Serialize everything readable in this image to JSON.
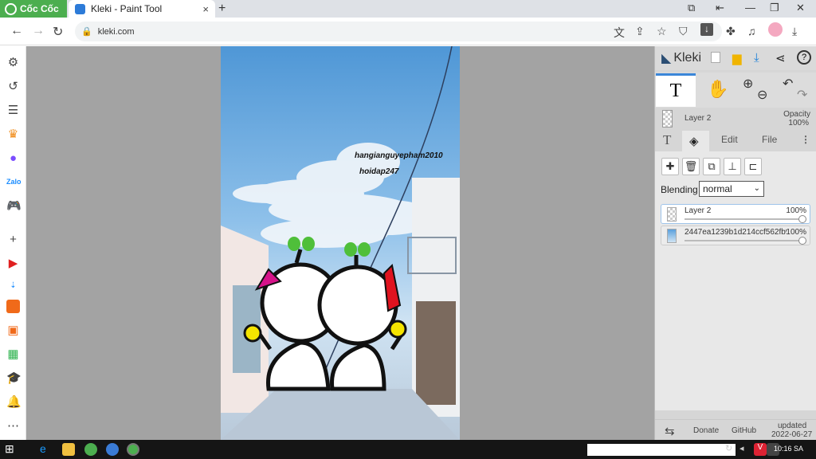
{
  "browser": {
    "brand": "Cốc Cốc",
    "tab_title": "Kleki - Paint Tool",
    "tab_close": "×",
    "new_tab": "+",
    "url": "kleki.com"
  },
  "canvas": {
    "watermark_line1": "hangianguyepham2010",
    "watermark_line2": "hoidap247"
  },
  "kleki": {
    "logo": "Kleki",
    "current_layer": "Layer 2",
    "opacity_label": "Opacity",
    "opacity_value": "100%",
    "tabs": {
      "edit": "Edit",
      "file": "File"
    },
    "blending_label": "Blending",
    "blending_value": "normal",
    "layers": [
      {
        "name": "Layer 2",
        "opacity": "100%"
      },
      {
        "name": "2447ea1239b1d214ccf562fb9",
        "opacity": "100%"
      }
    ],
    "footer": {
      "donate": "Donate",
      "github": "GitHub",
      "updated_label": "updated",
      "updated_date": "2022-06-27"
    }
  },
  "taskbar": {
    "time": "10:16 SA"
  },
  "colors": {
    "brand_green": "#4cae4f",
    "accent_blue": "#3b86d8",
    "workspace_gray": "#a3a3a3"
  }
}
